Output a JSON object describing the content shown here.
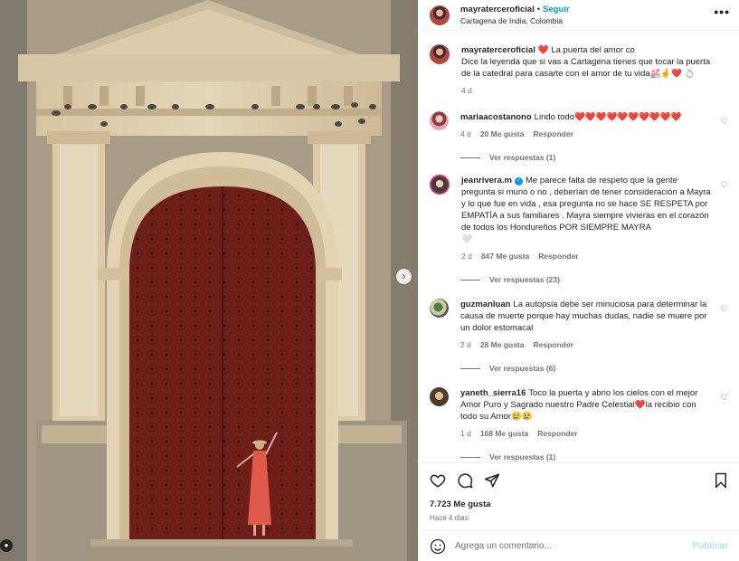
{
  "post": {
    "username": "mayraterceroficial",
    "follow_label": "Seguir",
    "separator": "•",
    "location": "Cartagena de India, Colombia",
    "more_icon": "more-options-icon"
  },
  "caption": {
    "username": "mayraterceroficial",
    "title_suffix": "La puerta del amor co",
    "text": "Dice la leyenda que si vas a Cartagena tienes que tocar la puerta de la catedral para casarte con el amor de tu vida",
    "emoji_tail": "💒🤞❤️ 💍",
    "emoji_lead": "❤️",
    "age": "4 d"
  },
  "comments": [
    {
      "username": "mariaacostanono",
      "text": "Lindo todo",
      "emoji_tail": "❤️❤️❤️❤️❤️❤️❤️❤️❤️❤️",
      "age": "4 d",
      "likes": "20 Me gusta",
      "reply_label": "Responder",
      "view_replies": "Ver respuestas (1)"
    },
    {
      "username": "jeanrivera.m",
      "verified": true,
      "text": "Me parece falta de respeto que la gente pregunta si murió o no , deberían de tener consideración a Mayra y lo que fue en vida , esa pregunta no se hace SE RESPETA por EMPATÍA a sus familiares . Mayra siempre vivieras en el corazón de todos los Hondureños POR SIEMPRE MAYRA",
      "emoji_tail": "🤍",
      "age": "2 d",
      "likes": "847 Me gusta",
      "reply_label": "Responder",
      "view_replies": "Ver respuestas (23)"
    },
    {
      "username": "guzmanluan",
      "text": "La autopsia debe ser minuciosa para determinar la causa de muerte porque hay muchas dudas, nadie se muere por un dolor estomacal",
      "emoji_tail": "",
      "age": "2 d",
      "likes": "28 Me gusta",
      "reply_label": "Responder",
      "view_replies": "Ver respuestas (6)"
    },
    {
      "username": "yaneth_sierra16",
      "text": "Toco la puerta y abrio los cielos con el mejor Amor Puro y Sagrado nuestro Padre Celestial",
      "text_mid_emoji": "❤️",
      "text_after": "la recibio con todo su Amor",
      "emoji_tail": "😢😢",
      "age": "1 d",
      "likes": "168 Me gusta",
      "reply_label": "Responder",
      "view_replies": "Ver respuestas (1)"
    }
  ],
  "actions": {
    "like_count": "7.723 Me gusta",
    "posted_ago": "Hace 4 días"
  },
  "add_comment": {
    "placeholder": "Agrega un comentario...",
    "publish_label": "Publicar"
  },
  "colors": {
    "accent": "#0095f6",
    "heart": "#e0143c",
    "door": "#6e1f1a",
    "stone": "#d8c8a8"
  }
}
